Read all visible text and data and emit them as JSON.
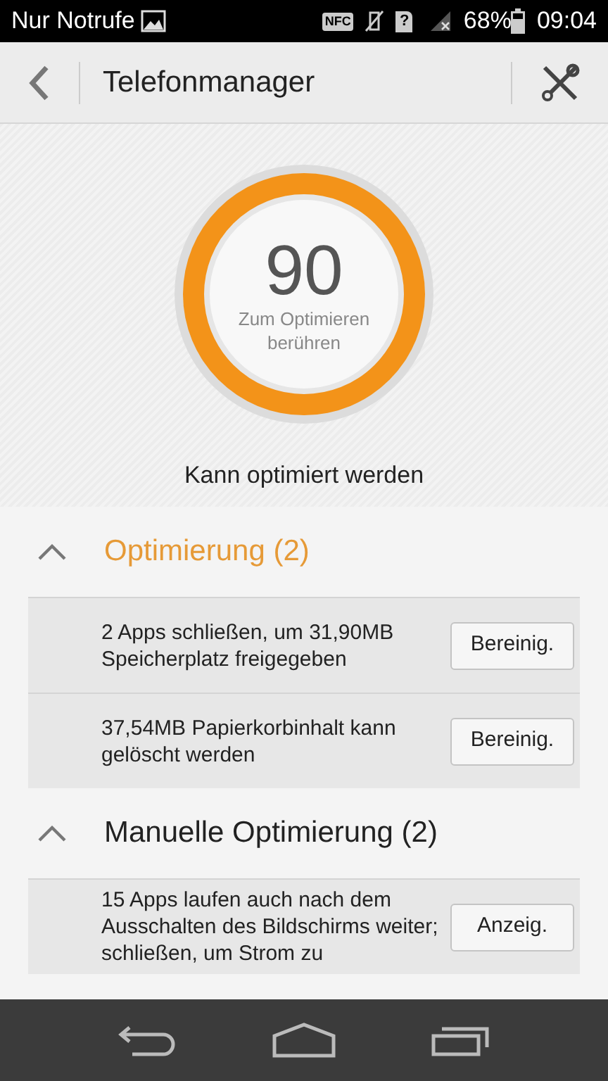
{
  "status_bar": {
    "carrier": "Nur Notrufe",
    "nfc": "NFC",
    "sim": "?",
    "battery": "68%",
    "time": "09:04"
  },
  "app_bar": {
    "title": "Telefonmanager"
  },
  "score": {
    "value": "90",
    "hint": "Zum Optimieren berühren",
    "status": "Kann optimiert werden"
  },
  "sections": [
    {
      "title": "Optimierung (2)",
      "expanded": true,
      "highlighted": true,
      "items": [
        {
          "text": "2 Apps schließen, um 31,90MB Speicherplatz freigegeben",
          "action": "Bereinig."
        },
        {
          "text": "37,54MB Papierkorbinhalt kann gelöscht werden",
          "action": "Bereinig."
        }
      ]
    },
    {
      "title": "Manuelle Optimierung (2)",
      "expanded": true,
      "highlighted": false,
      "items": [
        {
          "text": "15 Apps laufen auch nach dem Ausschalten des Bildschirms weiter; schließen, um Strom zu",
          "action": "Anzeig."
        }
      ]
    }
  ]
}
